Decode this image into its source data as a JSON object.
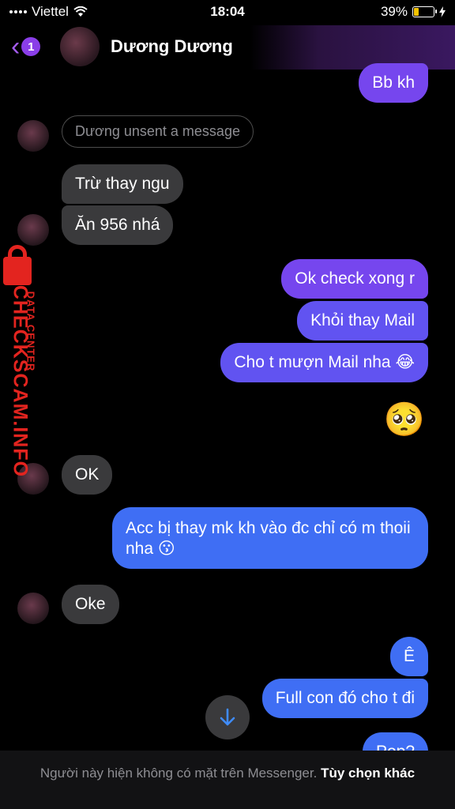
{
  "status_bar": {
    "carrier": "Viettel",
    "time": "18:04",
    "battery_percent": "39%",
    "battery_level": 0.39
  },
  "header": {
    "back_badge_count": "1",
    "contact_name": "Dương Dương"
  },
  "messages": {
    "m1": "Bb kh",
    "unsent_notice": "Dương unsent a message",
    "m2": "Trừ thay ngu",
    "m3": "Ăn 956 nhá",
    "m4": "Ok check xong r",
    "m5": "Khỏi thay Mail",
    "m6": "Cho t mượn Mail nha 😂",
    "m7": "🥺",
    "m8": "OK",
    "m9": "Acc bị thay mk kh vào đc chỉ có m thoii nha 😗",
    "m10": "Oke",
    "m11": "Ê",
    "m12": "Full con đó cho t đi",
    "m13": "Pop?"
  },
  "footer": {
    "notice": "Người này hiện không có mặt trên Messenger.",
    "action": "Tùy chọn khác"
  },
  "watermark": {
    "brand": "CHECKSCAM.INFO",
    "subtitle": "DATA CENTER"
  },
  "colors": {
    "accent": "#7646ee",
    "incoming": "#3a3a3c",
    "outgoing_blue": "#3f6ef4"
  }
}
